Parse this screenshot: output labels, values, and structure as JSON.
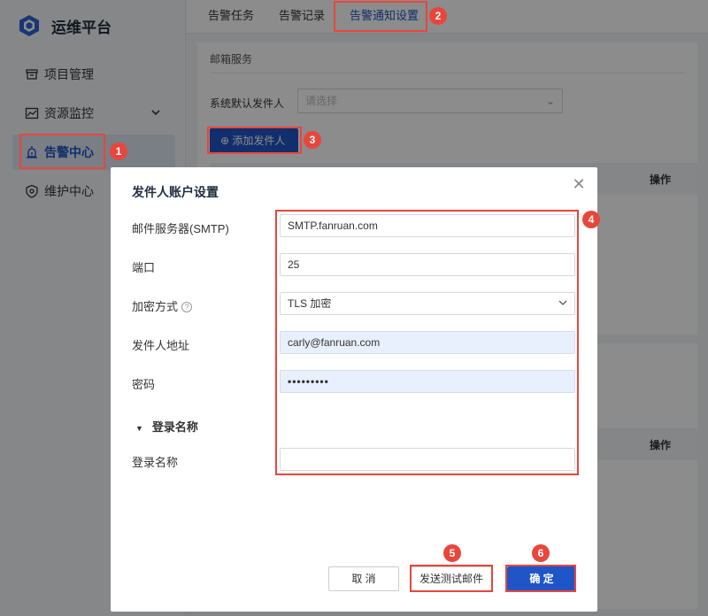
{
  "app": {
    "title": "运维平台"
  },
  "sidebar": {
    "items": [
      {
        "label": "项目管理",
        "icon": "archive-icon"
      },
      {
        "label": "资源监控",
        "icon": "monitor-chart-icon",
        "expandable": true
      },
      {
        "label": "告警中心",
        "icon": "alarm-icon",
        "active": true
      },
      {
        "label": "维护中心",
        "icon": "maintenance-icon"
      }
    ]
  },
  "tabs": [
    {
      "label": "告警任务"
    },
    {
      "label": "告警记录"
    },
    {
      "label": "告警通知设置",
      "active": true
    }
  ],
  "mail_section": {
    "title": "邮箱服务",
    "default_sender_label": "系统默认发件人",
    "default_sender_placeholder": "请选择",
    "add_sender_button": "添加发件人",
    "table_op_header": "操作"
  },
  "second_section": {
    "table_op_header": "操作"
  },
  "dialog": {
    "title": "发件人账户设置",
    "fields": {
      "smtp": {
        "label": "邮件服务器(SMTP)",
        "value": "SMTP.fanruan.com"
      },
      "port": {
        "label": "端口",
        "value": "25"
      },
      "encryption": {
        "label": "加密方式",
        "value": "TLS 加密"
      },
      "sender_address": {
        "label": "发件人地址",
        "value": "carly@fanruan.com"
      },
      "password": {
        "label": "密码",
        "value": "•••••••••"
      },
      "login_group": {
        "label": "登录名称"
      },
      "login_name": {
        "label": "登录名称",
        "value": ""
      }
    },
    "buttons": {
      "cancel": "取 消",
      "test": "发送测试邮件",
      "confirm": "确 定"
    }
  },
  "annotations": [
    "1",
    "2",
    "3",
    "4",
    "5",
    "6"
  ],
  "colors": {
    "accent": "#1f55c7",
    "annotation": "#e8463c",
    "active_nav_bg": "#dfe6f3"
  }
}
